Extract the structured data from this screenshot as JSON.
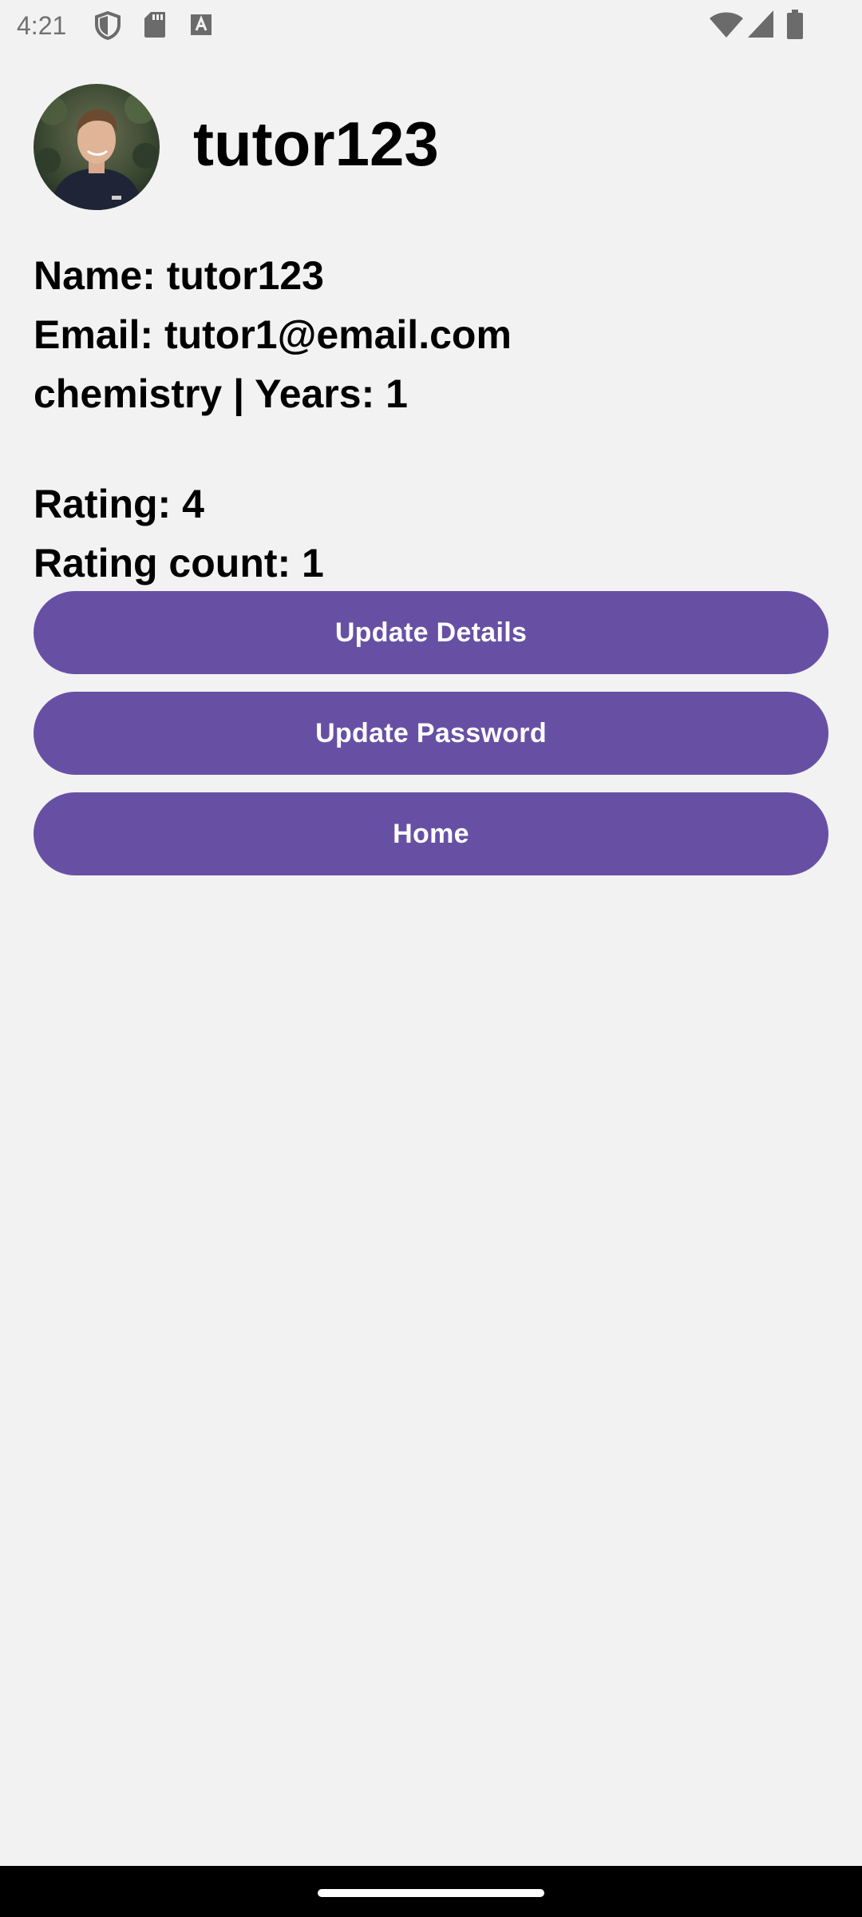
{
  "status_bar": {
    "time": "4:21",
    "icons_left": [
      "shield-icon",
      "sd-card-icon",
      "font-a-icon"
    ],
    "icons_right": [
      "wifi-icon",
      "cell-signal-icon",
      "battery-icon"
    ]
  },
  "profile": {
    "username": "tutor123",
    "avatar_icon": "profile-photo"
  },
  "details": {
    "name_line": "Name: tutor123",
    "email_line": "Email: tutor1@email.com",
    "subject_line": "chemistry | Years: 1",
    "rating_line": "Rating: 4",
    "rating_count_line": "Rating count: 1"
  },
  "buttons": {
    "update_details": "Update Details",
    "update_password": "Update Password",
    "home": "Home"
  },
  "colors": {
    "background": "#f2f2f2",
    "button": "#6750a4",
    "button_text": "#ffffff",
    "text": "#000000"
  }
}
